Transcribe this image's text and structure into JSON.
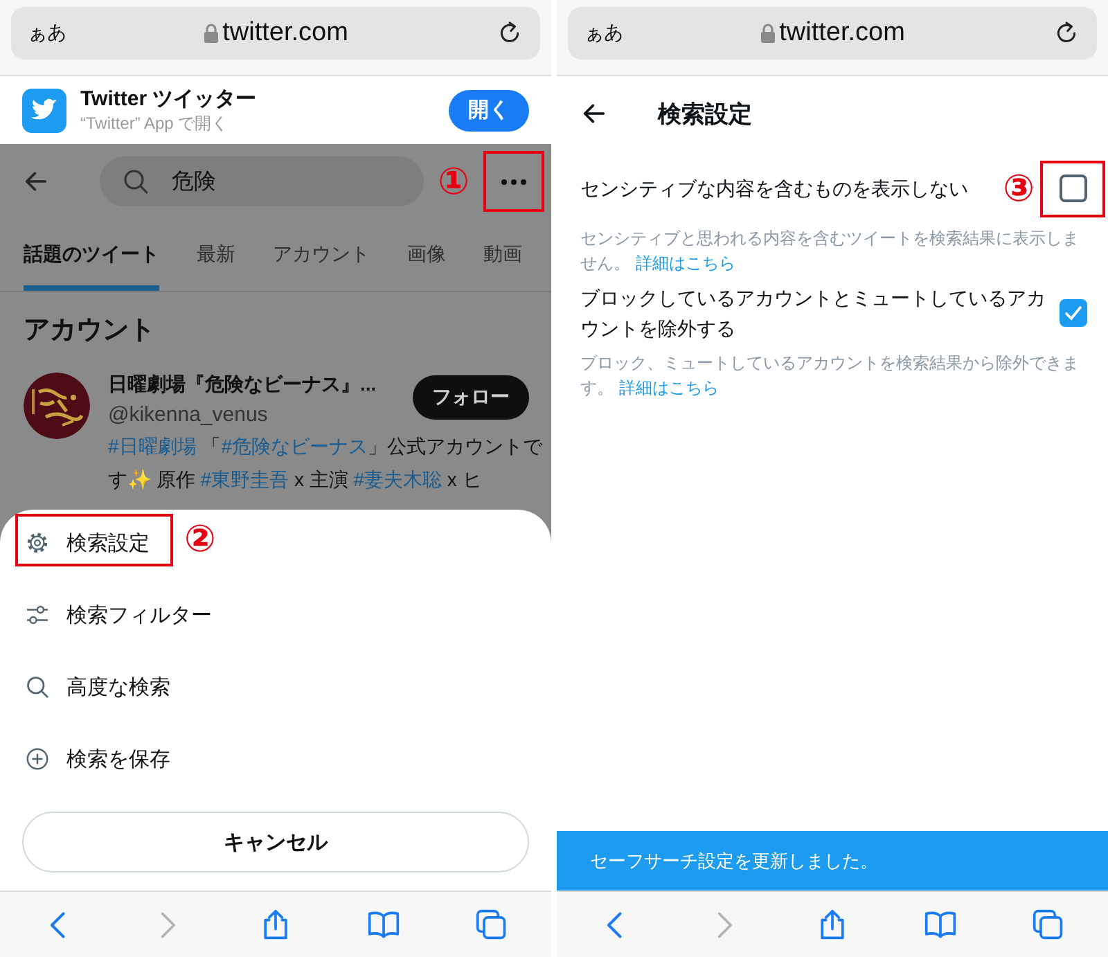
{
  "panels": [
    {
      "kind": "search_menu",
      "address_bar": {
        "text_size": "ぁあ",
        "domain": "twitter.com"
      },
      "app_banner": {
        "title": "Twitter ツイッター",
        "subtitle": "“Twitter” App で開く",
        "button": "開く"
      },
      "dimmed": true,
      "search": {
        "value": "危険"
      },
      "more_button": {
        "annotation": "①"
      },
      "tabs": [
        {
          "label": "話題のツイート",
          "selected": true
        },
        {
          "label": "最新",
          "selected": false
        },
        {
          "label": "アカウント",
          "selected": false
        },
        {
          "label": "画像",
          "selected": false
        },
        {
          "label": "動画",
          "selected": false
        }
      ],
      "section_title": "アカウント",
      "account": {
        "name": "日曜劇場『危険なビーナス』...",
        "handle": "@kikenna_venus",
        "button": "フォロー",
        "bio": [
          {
            "text": "#日曜劇場",
            "kind": "hashtag"
          },
          {
            "text": " 「",
            "kind": "plain"
          },
          {
            "text": "#危険なビーナス",
            "kind": "hashtag"
          },
          {
            "text": "」公式アカウントです✨ 原作 ",
            "kind": "plain"
          },
          {
            "text": "#東野圭吾",
            "kind": "hashtag"
          },
          {
            "text": " x 主演 ",
            "kind": "plain"
          },
          {
            "text": "#妻夫木聡",
            "kind": "hashtag"
          },
          {
            "text": " x ヒ",
            "kind": "plain"
          }
        ]
      },
      "menu": {
        "items": [
          {
            "label": "検索設定",
            "annotation": "②"
          },
          {
            "label": "検索フィルター"
          },
          {
            "label": "高度な検索"
          },
          {
            "label": "検索を保存"
          }
        ],
        "cancel": "キャンセル"
      },
      "toolbar": [
        {
          "kind": "back",
          "disabled": false
        },
        {
          "kind": "forward",
          "disabled": true
        },
        {
          "kind": "share",
          "disabled": false
        },
        {
          "kind": "bookmarks",
          "disabled": false
        },
        {
          "kind": "tabs",
          "disabled": false
        }
      ]
    },
    {
      "kind": "search_settings",
      "address_bar": {
        "text_size": "ぁあ",
        "domain": "twitter.com"
      },
      "title": "検索設定",
      "settings": [
        {
          "label": "センシティブな内容を含むものを表示しない",
          "annotation": "③",
          "checked": false,
          "description": "センシティブと思われる内容を含むツイートを検索結果に表示しません。",
          "link": "詳細はこちら"
        },
        {
          "label": "ブロックしているアカウントとミュートしているアカウントを除外する",
          "checked": true,
          "description": "ブロック、ミュートしているアカウントを検索結果から除外できます。",
          "link": "詳細はこちら"
        }
      ],
      "toast": "セーフサーチ設定を更新しました。",
      "toolbar": [
        {
          "kind": "back",
          "disabled": false
        },
        {
          "kind": "forward",
          "disabled": true
        },
        {
          "kind": "share",
          "disabled": false
        },
        {
          "kind": "bookmarks",
          "disabled": false
        },
        {
          "kind": "tabs",
          "disabled": false
        }
      ]
    }
  ]
}
